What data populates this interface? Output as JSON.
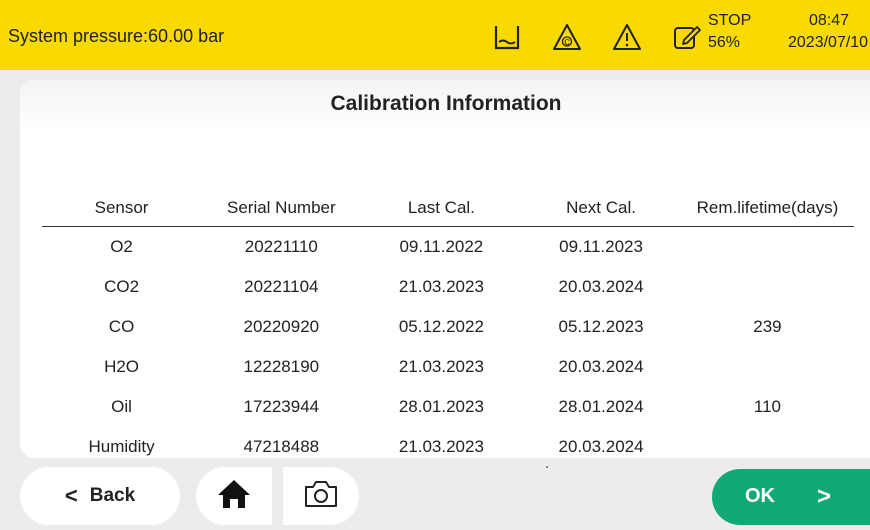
{
  "status": {
    "pressure_text": "System pressure:60.00 bar",
    "stop_label": "STOP",
    "stop_percent": "56%",
    "time": "08:47",
    "date": "2023/07/10",
    "icons": [
      "container-icon",
      "warning-c-icon",
      "warning-icon",
      "edit-icon"
    ],
    "bar_color": "#f8d900"
  },
  "panel": {
    "title": "Calibration Information"
  },
  "table": {
    "headers": [
      "Sensor",
      "Serial Number",
      "Last Cal.",
      "Next Cal.",
      "Rem.lifetime(days)"
    ],
    "rows": [
      [
        "O2",
        "20221110",
        "09.11.2022",
        "09.11.2023",
        ""
      ],
      [
        "CO2",
        "20221104",
        "21.03.2023",
        "20.03.2024",
        ""
      ],
      [
        "CO",
        "20220920",
        "05.12.2022",
        "05.12.2023",
        "239"
      ],
      [
        "H2O",
        "12228190",
        "21.03.2023",
        "20.03.2024",
        ""
      ],
      [
        "Oil",
        "17223944",
        "28.01.2023",
        "28.01.2024",
        "110"
      ],
      [
        "Humidity",
        "47218488",
        "21.03.2023",
        "20.03.2024",
        ""
      ]
    ]
  },
  "footer": {
    "back_label": "Back",
    "ok_label": "OK",
    "ok_color": "#13a878",
    "home_icon": "home-icon",
    "camera_icon": "camera-icon"
  }
}
